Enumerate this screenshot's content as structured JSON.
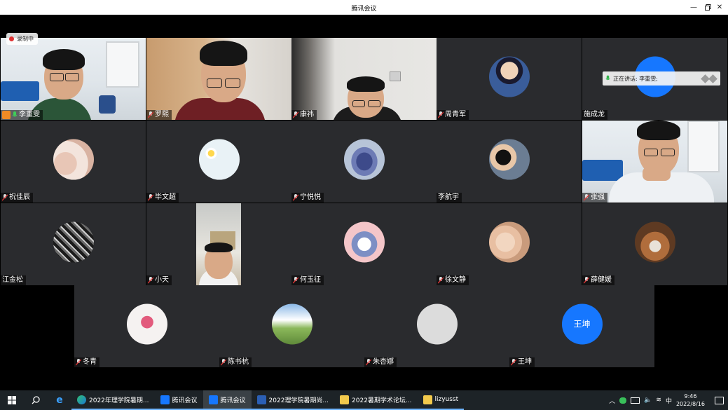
{
  "window": {
    "title": "腾讯会议"
  },
  "recording": {
    "label": "录制中"
  },
  "speaking": {
    "label": "正在讲话: 李重雯;"
  },
  "colors": {
    "accent": "#1677ff",
    "speaking_border": "#2fb34a",
    "tile_bg": "#2a2b2e"
  },
  "participants": [
    {
      "name": "李重雯",
      "mic": "on",
      "video": "camera"
    },
    {
      "name": "罗熙",
      "mic": "muted",
      "video": "camera"
    },
    {
      "name": "康祎",
      "mic": "muted",
      "video": "camera"
    },
    {
      "name": "周青军",
      "mic": "muted",
      "video": "avatar"
    },
    {
      "name": "施成龙",
      "mic": "none",
      "video": "avatar"
    },
    {
      "name": "祝佳辰",
      "mic": "muted",
      "video": "avatar"
    },
    {
      "name": "毕文超",
      "mic": "muted",
      "video": "avatar"
    },
    {
      "name": "宁悦悦",
      "mic": "muted",
      "video": "avatar"
    },
    {
      "name": "李航宇",
      "mic": "none",
      "video": "avatar"
    },
    {
      "name": "张强",
      "mic": "muted",
      "video": "camera"
    },
    {
      "name": "江金松",
      "mic": "none",
      "video": "avatar"
    },
    {
      "name": "小天",
      "mic": "muted",
      "video": "camera"
    },
    {
      "name": "何玉征",
      "mic": "muted",
      "video": "avatar"
    },
    {
      "name": "徐文静",
      "mic": "muted",
      "video": "avatar"
    },
    {
      "name": "薛健媛",
      "mic": "muted",
      "video": "avatar"
    },
    {
      "name": "冬青",
      "mic": "muted",
      "video": "avatar"
    },
    {
      "name": "陈书杭",
      "mic": "muted",
      "video": "avatar"
    },
    {
      "name": "朱杏娜",
      "mic": "muted",
      "video": "avatar"
    },
    {
      "name": "王坤",
      "mic": "muted",
      "video": "avatar",
      "avatar_text": "王坤"
    }
  ],
  "taskbar": {
    "apps": [
      {
        "label": "2022年理学院暑期...",
        "icon": "edge-icon"
      },
      {
        "label": "腾讯会议",
        "icon": "tencent-meeting-icon"
      },
      {
        "label": "腾讯会议",
        "icon": "tencent-meeting-icon"
      },
      {
        "label": "2022理学院暑期尚...",
        "icon": "word-icon"
      },
      {
        "label": "2022暑期学术论坛...",
        "icon": "folder-icon"
      },
      {
        "label": "lizyusst",
        "icon": "folder-icon"
      }
    ],
    "ime": "中",
    "time": "9:46",
    "date": "2022/8/16"
  }
}
